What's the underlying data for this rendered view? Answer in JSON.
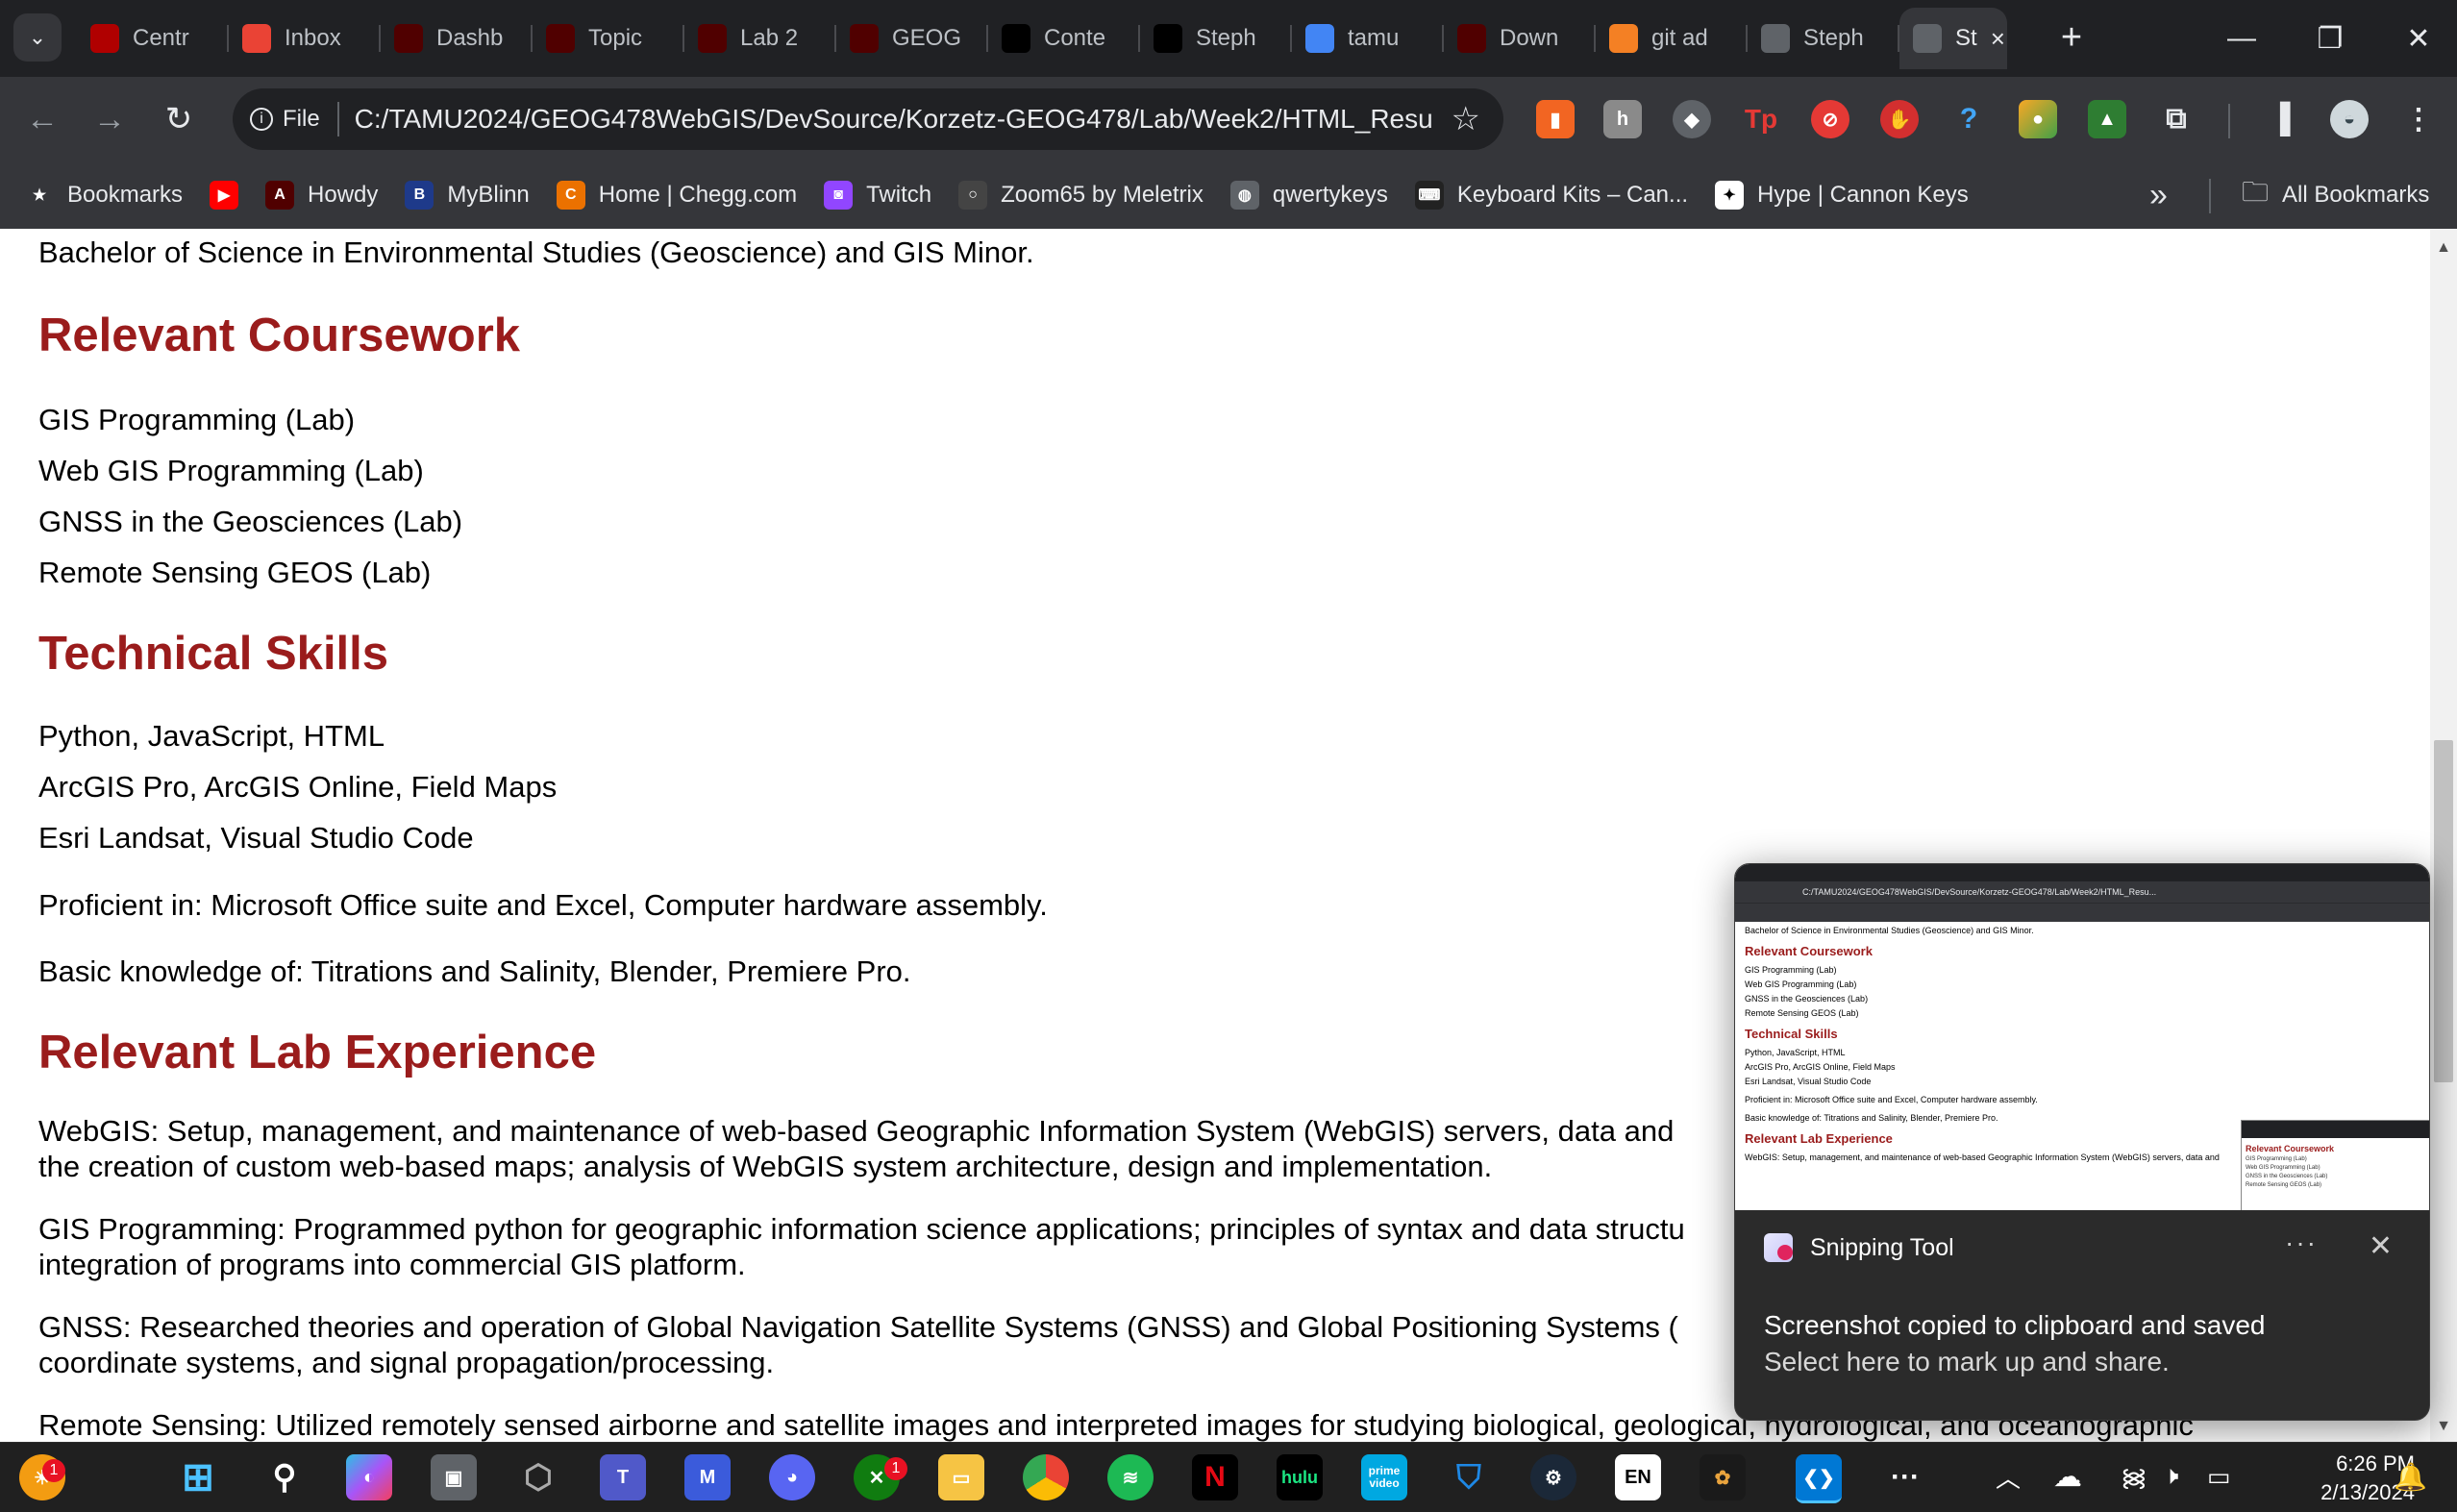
{
  "browser": {
    "tabs": [
      {
        "label": "Centr",
        "icon": "it-icon",
        "color": "#b00000"
      },
      {
        "label": "Inbox",
        "icon": "gmail-icon",
        "color": "#ea4335"
      },
      {
        "label": "Dashb",
        "icon": "tamu-icon",
        "color": "#500000"
      },
      {
        "label": "Topic",
        "icon": "tamu-icon",
        "color": "#500000"
      },
      {
        "label": "Lab 2",
        "icon": "tamu-icon",
        "color": "#500000"
      },
      {
        "label": "GEOG",
        "icon": "tamu-icon",
        "color": "#500000"
      },
      {
        "label": "Conte",
        "icon": "github-icon",
        "color": "#000000"
      },
      {
        "label": "Steph",
        "icon": "github-icon",
        "color": "#000000"
      },
      {
        "label": "tamu",
        "icon": "google-icon",
        "color": "#4285f4"
      },
      {
        "label": "Down",
        "icon": "tamu-icon",
        "color": "#500000"
      },
      {
        "label": "git ad",
        "icon": "stackoverflow-icon",
        "color": "#f48024"
      },
      {
        "label": "Steph",
        "icon": "globe-icon",
        "color": "#5f6368"
      },
      {
        "label": "St",
        "icon": "globe-icon",
        "color": "#5f6368",
        "active": true
      }
    ],
    "omnibox": {
      "chip": "File",
      "url": "C:/TAMU2024/GEOG478WebGIS/DevSource/Korzetz-GEOG478/Lab/Week2/HTML_Resu..."
    },
    "bookmarks": [
      {
        "label": "Bookmarks",
        "icon": "star-icon"
      },
      {
        "label": "",
        "icon": "youtube-icon"
      },
      {
        "label": "Howdy",
        "icon": "tamu-icon"
      },
      {
        "label": "MyBlinn",
        "icon": "blinn-icon"
      },
      {
        "label": "Home | Chegg.com",
        "icon": "chegg-icon"
      },
      {
        "label": "Twitch",
        "icon": "twitch-icon"
      },
      {
        "label": "Zoom65 by Meletrix",
        "icon": "meletrix-icon"
      },
      {
        "label": "qwertykeys",
        "icon": "globe-icon"
      },
      {
        "label": "Keyboard Kits – Can...",
        "icon": "keyboard-icon"
      },
      {
        "label": "Hype | Cannon Keys",
        "icon": "cannonkeys-icon"
      }
    ],
    "bookmarks_overflow": "»",
    "all_bookmarks": "All Bookmarks"
  },
  "page": {
    "intro": "Bachelor of Science in Environmental Studies (Geoscience) and GIS Minor.",
    "coursework_heading": "Relevant Coursework",
    "coursework": [
      "GIS Programming (Lab)",
      "Web GIS Programming (Lab)",
      "GNSS in the Geosciences (Lab)",
      "Remote Sensing GEOS (Lab)"
    ],
    "skills_heading": "Technical Skills",
    "skills": [
      "Python, JavaScript, HTML",
      "ArcGIS Pro, ArcGIS Online, Field Maps",
      "Esri Landsat, Visual Studio Code"
    ],
    "proficient": "Proficient in: Microsoft Office suite and Excel, Computer hardware assembly.",
    "basic": "Basic knowledge of: Titrations and Salinity, Blender, Premiere Pro.",
    "lab_heading": "Relevant Lab Experience",
    "lab_items": [
      {
        "line1": "WebGIS: Setup, management, and maintenance of web-based Geographic Information System (WebGIS) servers, data and",
        "line2": "the creation of custom web-based maps; analysis of WebGIS system architecture, design and implementation."
      },
      {
        "line1": "GIS Programming: Programmed python for geographic information science applications; principles of syntax and data structu",
        "line2": "integration of programs into commercial GIS platform."
      },
      {
        "line1": "GNSS: Researched theories and operation of Global Navigation Satellite Systems (GNSS) and Global Positioning Systems (",
        "line2": "coordinate systems, and signal propagation/processing."
      },
      {
        "line1": "Remote Sensing: Utilized remotely sensed airborne and satellite images and interpreted images for studying biological, geological, hydrological, and oceanographic",
        "line2": ""
      }
    ]
  },
  "toast": {
    "app_name": "Snipping Tool",
    "more": "···",
    "close": "✕",
    "line1": "Screenshot copied to clipboard and saved",
    "line2": "Select here to mark up and share."
  },
  "taskbar": {
    "lang": "EN",
    "time": "6:26 PM",
    "date": "2/13/2024",
    "notification_count": "1",
    "xbox_badge": "1",
    "hulu": "hulu",
    "prime": "prime video"
  }
}
